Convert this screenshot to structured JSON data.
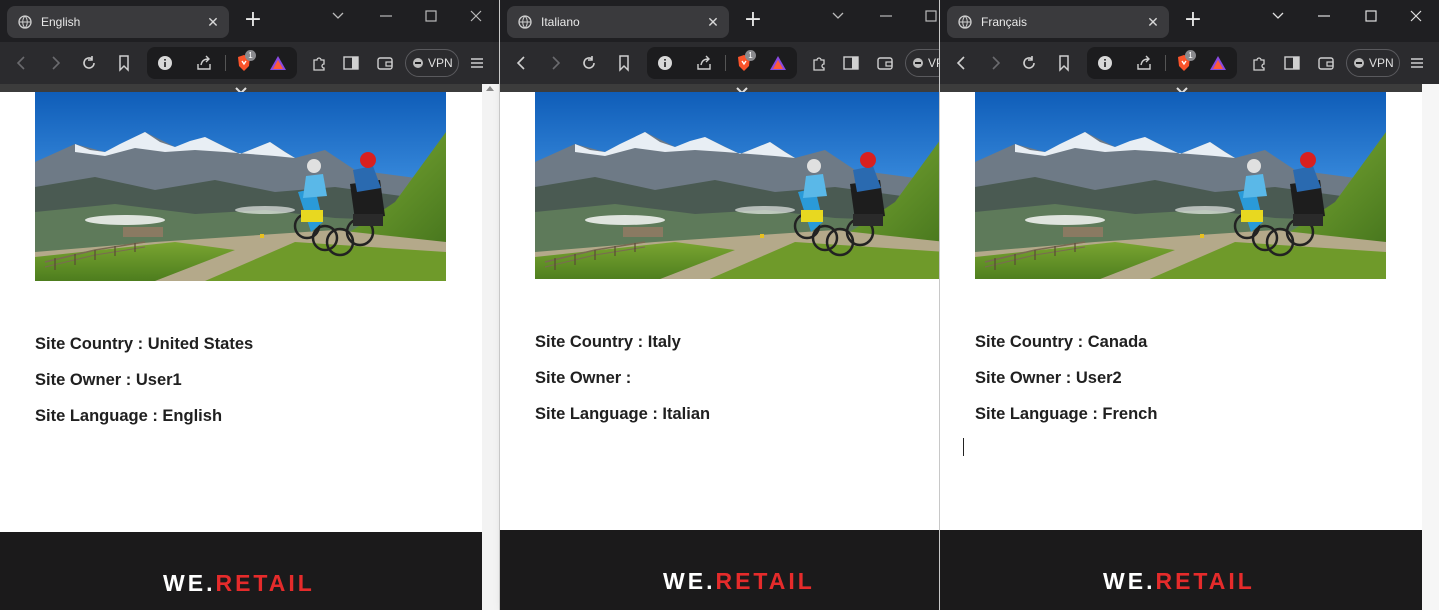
{
  "windows": [
    {
      "id": "en",
      "tab_title": "English",
      "vpn_label": "VPN",
      "brave_badge": "1",
      "site": {
        "country_line": "Site Country : United States",
        "owner_line": "Site Owner : User1",
        "language_line": "Site Language : English"
      },
      "footer_logo": {
        "we": "WE",
        "dot": ".",
        "retail": "RETAIL"
      }
    },
    {
      "id": "it",
      "tab_title": "Italiano",
      "vpn_label": "VPN",
      "brave_badge": "1",
      "site": {
        "country_line": "Site Country : Italy",
        "owner_line": "Site Owner :",
        "language_line": "Site Language : Italian"
      },
      "footer_logo": {
        "we": "WE",
        "dot": ".",
        "retail": "RETAIL"
      }
    },
    {
      "id": "fr",
      "tab_title": "Français",
      "vpn_label": "VPN",
      "brave_badge": "1",
      "site": {
        "country_line": "Site Country : Canada",
        "owner_line": "Site Owner : User2",
        "language_line": "Site Language : French"
      },
      "footer_logo": {
        "we": "WE",
        "dot": ".",
        "retail": "RETAIL"
      }
    }
  ],
  "colors": {
    "tab_strip": "#1f1f22",
    "active_tab": "#3a3a3d",
    "toolbar": "#2b2b2e",
    "footer": "#1b1a1b",
    "brand_red": "#e52b2b"
  }
}
